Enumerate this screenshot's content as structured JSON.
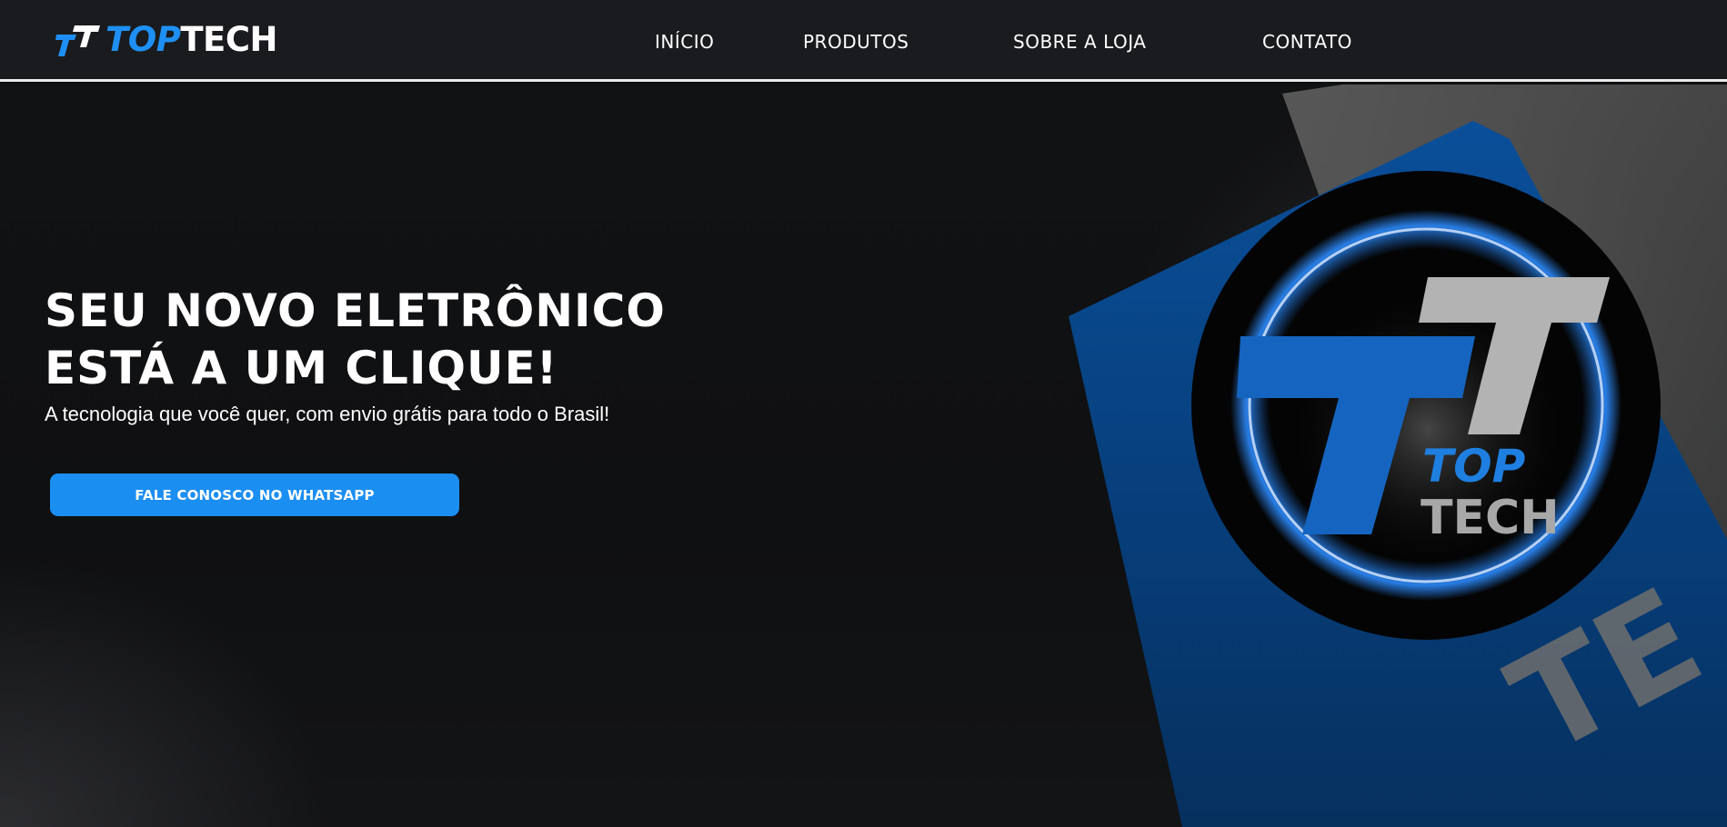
{
  "header": {
    "logo": {
      "part1": "TOP",
      "part2": "TECH"
    },
    "nav": [
      {
        "label": "INÍCIO"
      },
      {
        "label": "PRODUTOS"
      },
      {
        "label": "SOBRE A LOJA"
      },
      {
        "label": "CONTATO"
      }
    ]
  },
  "hero": {
    "title_line1": "SEU NOVO ELETRÔNICO",
    "title_line2": "ESTÁ A UM CLIQUE!",
    "subtitle": "A tecnologia que você quer, com envio grátis para todo o Brasil!",
    "cta_label": "FALE CONOSCO NO WHATSAPP",
    "badge": {
      "line1": "TOP",
      "line2": "TECH"
    },
    "backdrop_text": "TE"
  },
  "colors": {
    "brand_blue": "#1e90f5",
    "button_blue": "#1b8ef2",
    "header_bg": "#1a1b1e",
    "hero_bg": "#0f1012",
    "logo_gray": "#a8a8a8"
  },
  "icons": {
    "logo_mark": "tt-logo-icon",
    "badge": "toptech-badge-icon"
  }
}
